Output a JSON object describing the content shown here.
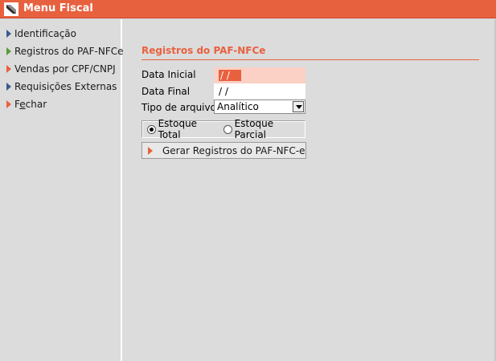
{
  "window": {
    "title": "Menu Fiscal",
    "title_bar_color": "#e8613f"
  },
  "sidebar": {
    "items": [
      {
        "label": "Identificação",
        "icon": "arrow-blue"
      },
      {
        "label": "Registros do PAF-NFCe",
        "icon": "arrow-green"
      },
      {
        "label": "Vendas por CPF/CNPJ",
        "icon": "arrow-orange"
      },
      {
        "label": "Requisições Externas",
        "icon": "arrow-blue"
      },
      {
        "label_prefix": "F",
        "label_underlined": "e",
        "label_suffix": "char",
        "icon": "arrow-orange"
      }
    ]
  },
  "main": {
    "section_title": "Registros do PAF-NFCe",
    "accent_color": "#e8613f",
    "fields": {
      "data_inicial": {
        "label": "Data Inicial",
        "value": " / /"
      },
      "data_final": {
        "label": "Data Final",
        "value": " / /"
      },
      "tipo_arquivo": {
        "label": "Tipo de arquivo",
        "value": "Analítico"
      }
    },
    "radio": {
      "estoque_total": {
        "label": "Estoque Total",
        "checked": true
      },
      "estoque_parcial": {
        "label": "Estoque Parcial",
        "checked": false
      }
    },
    "generate_button": {
      "label": "Gerar Registros do PAF-NFC-e"
    }
  }
}
